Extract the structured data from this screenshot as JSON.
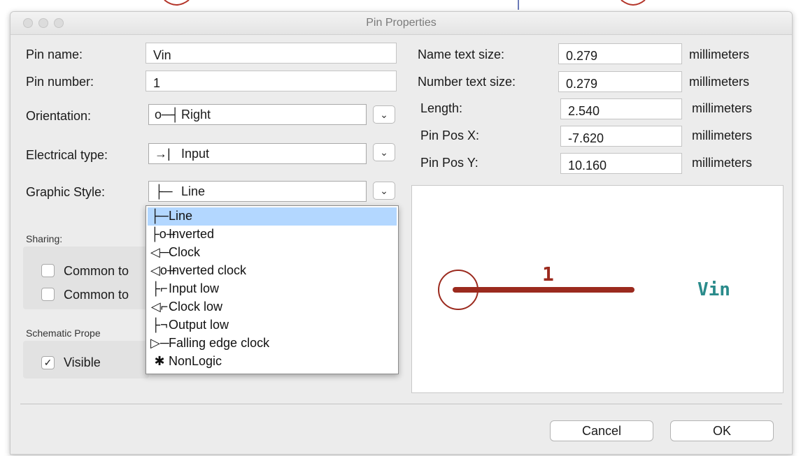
{
  "window": {
    "title": "Pin Properties"
  },
  "left": {
    "pin_name": {
      "label": "Pin name:",
      "value": "Vin"
    },
    "pin_number": {
      "label": "Pin number:",
      "value": "1"
    },
    "orientation": {
      "label": "Orientation:",
      "glyph": "o─┤",
      "value": "Right"
    },
    "electrical_type": {
      "label": "Electrical type:",
      "glyph": "→|",
      "value": "Input"
    },
    "graphic_style": {
      "label": "Graphic Style:",
      "glyph": "├─",
      "value": "Line"
    }
  },
  "sharing": {
    "label": "Sharing:",
    "options": [
      {
        "label": "Common to",
        "checked": false
      },
      {
        "label": "Common to",
        "checked": false
      }
    ]
  },
  "schematic": {
    "label": "Schematic Prope",
    "visible": {
      "label": "Visible",
      "checked": true,
      "mark": "✓"
    }
  },
  "dropdown": {
    "items": [
      {
        "glyph": "├─",
        "label": "Line",
        "selected": true
      },
      {
        "glyph": "├o─",
        "label": "Inverted",
        "selected": false
      },
      {
        "glyph": "◁─",
        "label": "Clock",
        "selected": false
      },
      {
        "glyph": "◁o─",
        "label": "Inverted clock",
        "selected": false
      },
      {
        "glyph": "├⌐",
        "label": "Input low",
        "selected": false
      },
      {
        "glyph": "◁⌐",
        "label": "Clock low",
        "selected": false
      },
      {
        "glyph": "├¬",
        "label": "Output low",
        "selected": false
      },
      {
        "glyph": "▷─",
        "label": "Falling edge clock",
        "selected": false
      },
      {
        "glyph": "✱",
        "label": "NonLogic",
        "selected": false
      }
    ]
  },
  "right": {
    "name_text_size": {
      "label": "Name text size:",
      "value": "0.279",
      "unit": "millimeters"
    },
    "number_text_size": {
      "label": "Number text size:",
      "value": "0.279",
      "unit": "millimeters"
    },
    "length": {
      "label": "Length:",
      "value": "2.540",
      "unit": "millimeters"
    },
    "pin_pos_x": {
      "label": "Pin Pos X:",
      "value": "-7.620",
      "unit": "millimeters"
    },
    "pin_pos_y": {
      "label": "Pin Pos Y:",
      "value": "10.160",
      "unit": "millimeters"
    }
  },
  "preview": {
    "pin_number": "1",
    "pin_name": "Vin",
    "pin_color": "#9b2a1e",
    "name_color": "#2a8b8b"
  },
  "buttons": {
    "cancel": "Cancel",
    "ok": "OK"
  },
  "dropdown_chevron": "⌄"
}
